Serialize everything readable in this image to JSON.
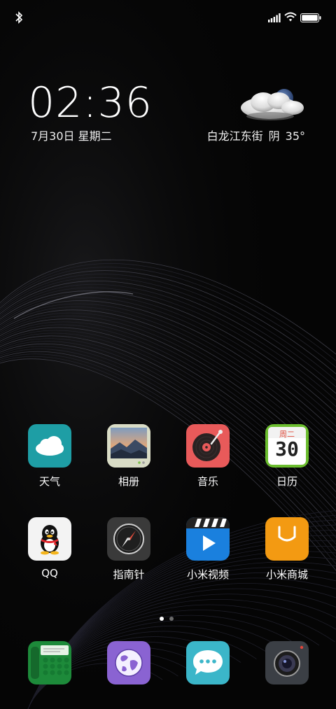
{
  "status_bar": {
    "bluetooth_icon": "bluetooth-icon",
    "signal_icon": "signal-bars-icon",
    "wifi_icon": "wifi-icon",
    "battery_icon": "battery-icon"
  },
  "lock_widget": {
    "time": "02:36",
    "date": "7月30日 星期二",
    "location": "白龙江东街",
    "condition": "阴",
    "temperature": "35°",
    "weather_icon": "cloudy-night-icon"
  },
  "apps": [
    {
      "label": "天气",
      "icon": "weather-cloud-icon",
      "color": "#1e9ea5"
    },
    {
      "label": "相册",
      "icon": "gallery-photo-icon",
      "color": "#d9dcc6"
    },
    {
      "label": "音乐",
      "icon": "music-record-icon",
      "color": "#e85a5a"
    },
    {
      "label": "日历",
      "icon": "calendar-icon",
      "color": "#6bbd2e",
      "day": "周二",
      "date_num": "30"
    },
    {
      "label": "QQ",
      "icon": "qq-penguin-icon",
      "color": "#f3f3f3"
    },
    {
      "label": "指南针",
      "icon": "compass-icon",
      "color": "#3a3a3a"
    },
    {
      "label": "小米视频",
      "icon": "video-play-icon",
      "color": "#1a80de"
    },
    {
      "label": "小米商城",
      "icon": "shopping-bag-icon",
      "color": "#f39a12"
    }
  ],
  "dock": [
    {
      "icon": "phone-dialer-icon",
      "color": "#1d8a3a"
    },
    {
      "icon": "browser-globe-icon",
      "color": "#8a63d2"
    },
    {
      "icon": "messages-bubble-icon",
      "color": "#3bb6c9"
    },
    {
      "icon": "camera-icon",
      "color": "#3b3f45"
    }
  ],
  "page_indicator": {
    "total": 2,
    "current": 1,
    "active_color": "#ffffff",
    "inactive_color": "#6a6a6a"
  }
}
